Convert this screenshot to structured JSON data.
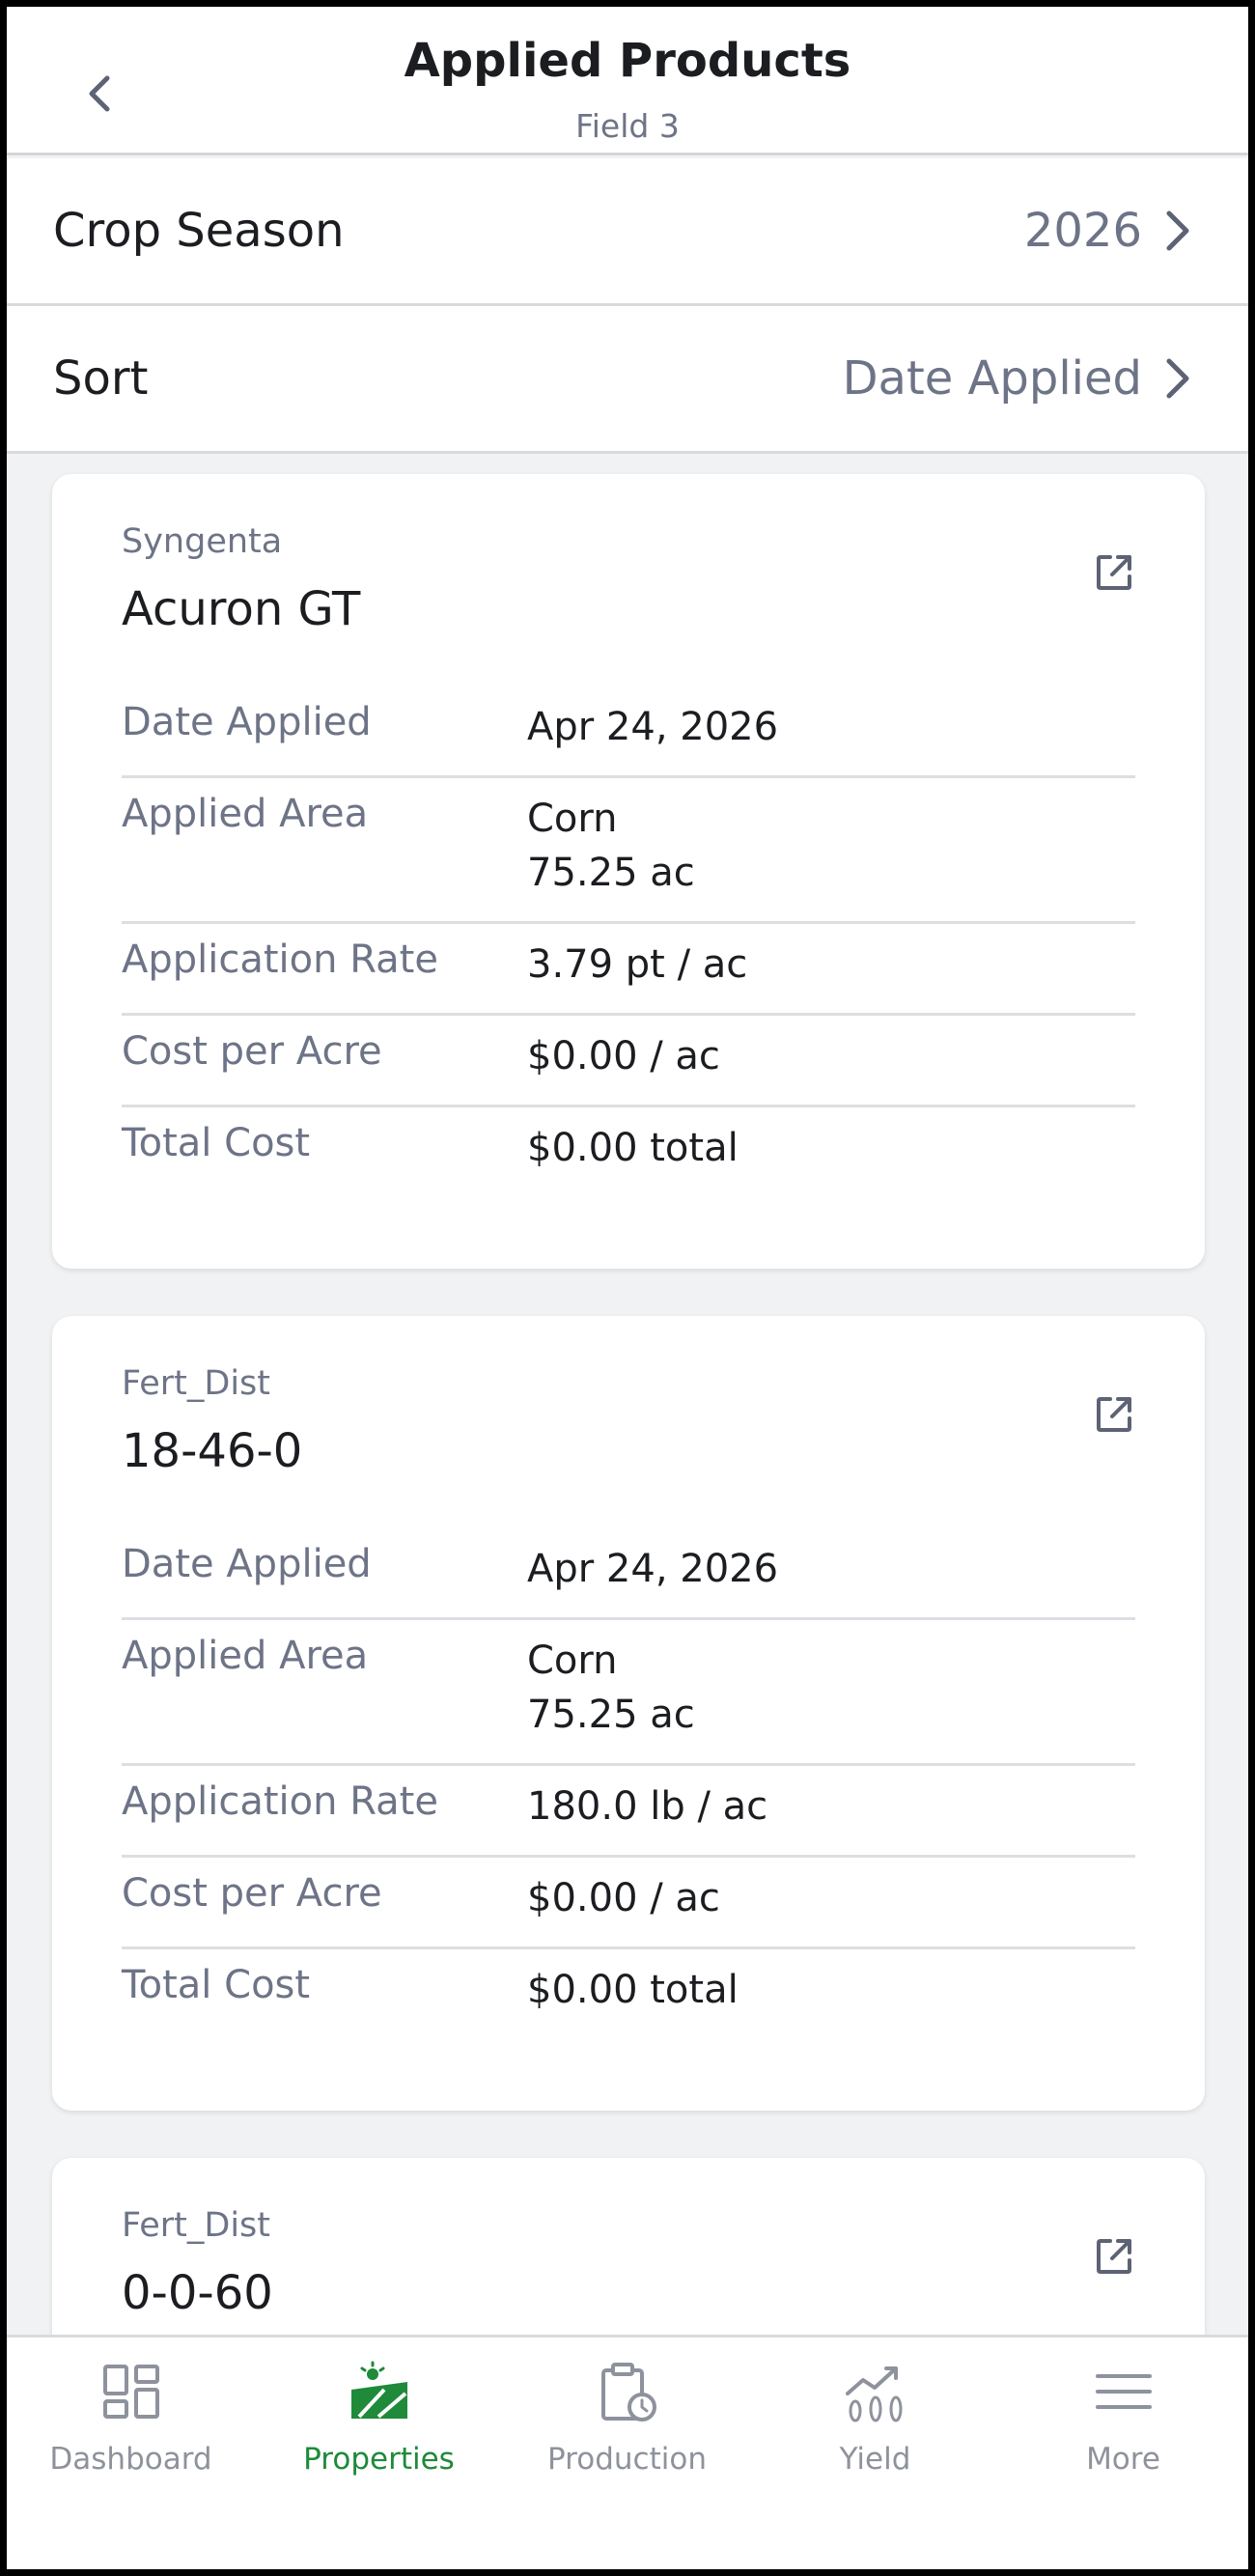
{
  "header": {
    "title": "Applied Products",
    "subtitle": "Field 3"
  },
  "crop_season": {
    "label": "Crop Season",
    "value": "2026"
  },
  "sort": {
    "label": "Sort",
    "value": "Date Applied"
  },
  "products": [
    {
      "brand": "Syngenta",
      "name": "Acuron GT",
      "rows": [
        {
          "label": "Date Applied",
          "value": [
            "Apr 24, 2026"
          ]
        },
        {
          "label": "Applied Area",
          "value": [
            "Corn",
            "75.25 ac"
          ]
        },
        {
          "label": "Application Rate",
          "value": [
            "3.79 pt / ac"
          ]
        },
        {
          "label": "Cost per Acre",
          "value": [
            "$0.00 / ac"
          ]
        },
        {
          "label": "Total Cost",
          "value": [
            "$0.00 total"
          ]
        }
      ]
    },
    {
      "brand": "Fert_Dist",
      "name": "18-46-0",
      "rows": [
        {
          "label": "Date Applied",
          "value": [
            "Apr 24, 2026"
          ]
        },
        {
          "label": "Applied Area",
          "value": [
            "Corn",
            "75.25 ac"
          ]
        },
        {
          "label": "Application Rate",
          "value": [
            "180.0 lb / ac"
          ]
        },
        {
          "label": "Cost per Acre",
          "value": [
            "$0.00 / ac"
          ]
        },
        {
          "label": "Total Cost",
          "value": [
            "$0.00 total"
          ]
        }
      ]
    },
    {
      "brand": "Fert_Dist",
      "name": "0-0-60",
      "rows": []
    }
  ],
  "tabs": [
    {
      "label": "Dashboard",
      "icon": "dashboard-icon",
      "active": false
    },
    {
      "label": "Properties",
      "icon": "properties-icon",
      "active": true
    },
    {
      "label": "Production",
      "icon": "production-icon",
      "active": false
    },
    {
      "label": "Yield",
      "icon": "yield-icon",
      "active": false
    },
    {
      "label": "More",
      "icon": "menu-icon",
      "active": false
    }
  ],
  "colors": {
    "accent": "#1e8a3a",
    "muted_text": "#6e7487",
    "inactive_tab": "#8e929c"
  }
}
